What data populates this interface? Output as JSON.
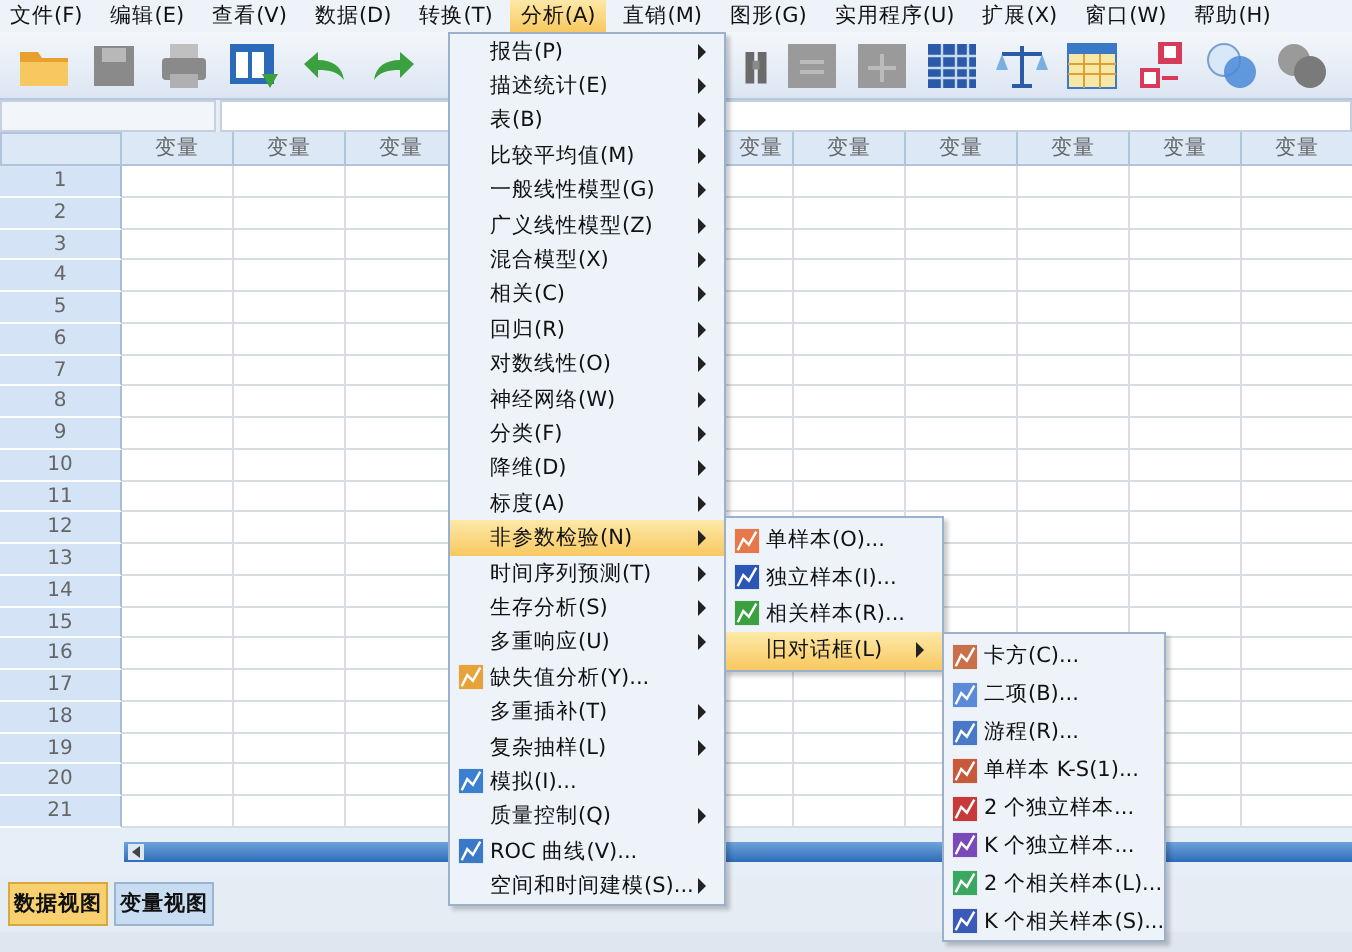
{
  "menu_bar": [
    {
      "label": "文件(F)",
      "selected": false
    },
    {
      "label": "编辑(E)",
      "selected": false
    },
    {
      "label": "查看(V)",
      "selected": false
    },
    {
      "label": "数据(D)",
      "selected": false
    },
    {
      "label": "转换(T)",
      "selected": false
    },
    {
      "label": "分析(A)",
      "selected": true
    },
    {
      "label": "直销(M)",
      "selected": false
    },
    {
      "label": "图形(G)",
      "selected": false
    },
    {
      "label": "实用程序(U)",
      "selected": false
    },
    {
      "label": "扩展(X)",
      "selected": false
    },
    {
      "label": "窗口(W)",
      "selected": false
    },
    {
      "label": "帮助(H)",
      "selected": false
    }
  ],
  "grid": {
    "columns_left": [
      "变量",
      "变量",
      "变量"
    ],
    "columns_right": [
      "变量",
      "变量",
      "变量",
      "变量",
      "变量",
      "变量"
    ],
    "rows": [
      "1",
      "2",
      "3",
      "4",
      "5",
      "6",
      "7",
      "8",
      "9",
      "10",
      "11",
      "12",
      "13",
      "14",
      "15",
      "16",
      "17",
      "18",
      "19",
      "20",
      "21"
    ]
  },
  "view_tabs": [
    {
      "label": "数据视图",
      "selected": true
    },
    {
      "label": "变量视图",
      "selected": false
    }
  ],
  "analyze_menu": [
    {
      "label": "报告(P)",
      "kind": "submenu",
      "selected": false
    },
    {
      "label": "描述统计(E)",
      "kind": "submenu",
      "selected": false
    },
    {
      "label": "表(B)",
      "kind": "submenu",
      "selected": false
    },
    {
      "label": "比较平均值(M)",
      "kind": "submenu",
      "selected": false
    },
    {
      "label": "一般线性模型(G)",
      "kind": "submenu",
      "selected": false
    },
    {
      "label": "广义线性模型(Z)",
      "kind": "submenu",
      "selected": false
    },
    {
      "label": "混合模型(X)",
      "kind": "submenu",
      "selected": false
    },
    {
      "label": "相关(C)",
      "kind": "submenu",
      "selected": false
    },
    {
      "label": "回归(R)",
      "kind": "submenu",
      "selected": false
    },
    {
      "label": "对数线性(O)",
      "kind": "submenu",
      "selected": false
    },
    {
      "label": "神经网络(W)",
      "kind": "submenu",
      "selected": false
    },
    {
      "label": "分类(F)",
      "kind": "submenu",
      "selected": false
    },
    {
      "label": "降维(D)",
      "kind": "submenu",
      "selected": false
    },
    {
      "label": "标度(A)",
      "kind": "submenu",
      "selected": false
    },
    {
      "label": "非参数检验(N)",
      "kind": "submenu",
      "selected": true
    },
    {
      "label": "时间序列预测(T)",
      "kind": "submenu",
      "selected": false
    },
    {
      "label": "生存分析(S)",
      "kind": "submenu",
      "selected": false
    },
    {
      "label": "多重响应(U)",
      "kind": "submenu",
      "selected": false
    },
    {
      "label": "缺失值分析(Y)...",
      "kind": "command",
      "selected": false
    },
    {
      "label": "多重插补(T)",
      "kind": "submenu",
      "selected": false
    },
    {
      "label": "复杂抽样(L)",
      "kind": "submenu",
      "selected": false
    },
    {
      "label": "模拟(I)...",
      "kind": "command",
      "selected": false
    },
    {
      "label": "质量控制(Q)",
      "kind": "submenu",
      "selected": false
    },
    {
      "label": "ROC 曲线(V)...",
      "kind": "command",
      "selected": false
    },
    {
      "label": "空间和时间建模(S)...",
      "kind": "submenu",
      "selected": false
    }
  ],
  "nonparametric_menu": [
    {
      "label": "单样本(O)...",
      "kind": "command",
      "selected": false
    },
    {
      "label": "独立样本(I)...",
      "kind": "command",
      "selected": false
    },
    {
      "label": "相关样本(R)...",
      "kind": "command",
      "selected": false
    },
    {
      "label": "旧对话框(L)",
      "kind": "submenu",
      "selected": true
    }
  ],
  "legacy_dialogs_menu": [
    {
      "label": "卡方(C)...",
      "kind": "command",
      "selected": false
    },
    {
      "label": "二项(B)...",
      "kind": "command",
      "selected": false
    },
    {
      "label": "游程(R)...",
      "kind": "command",
      "selected": false
    },
    {
      "label": "单样本 K-S(1)...",
      "kind": "command",
      "selected": false
    },
    {
      "label": "2 个独立样本...",
      "kind": "command",
      "selected": false
    },
    {
      "label": "K 个独立样本...",
      "kind": "command",
      "selected": false
    },
    {
      "label": "2 个相关样本(L)...",
      "kind": "command",
      "selected": false
    },
    {
      "label": "K 个相关样本(S)...",
      "kind": "command",
      "selected": false
    }
  ]
}
